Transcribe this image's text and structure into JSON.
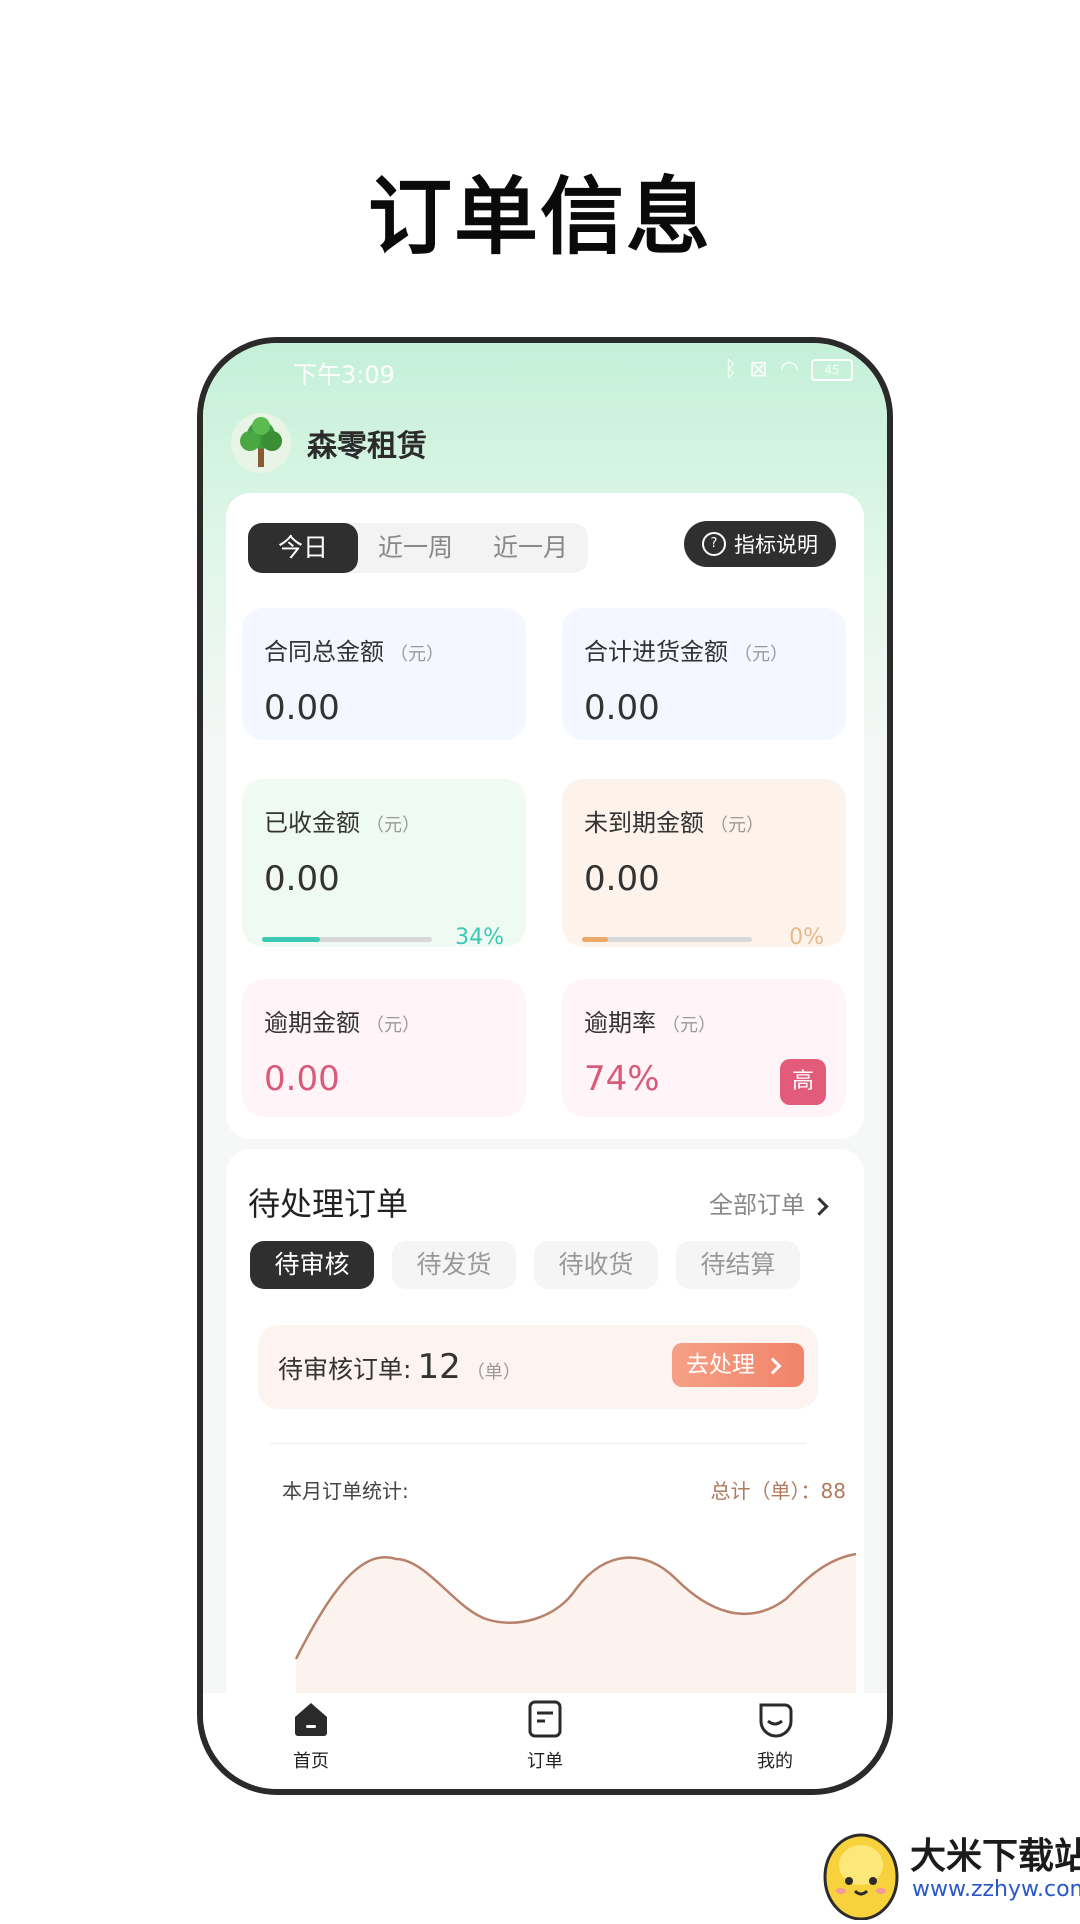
{
  "hero": {
    "title": "订单信息"
  },
  "status_bar": {
    "time": "下午3:09",
    "battery": "45"
  },
  "app": {
    "name": "森零租赁"
  },
  "overview": {
    "periods": [
      "今日",
      "近一周",
      "近一月"
    ],
    "selected_period": "今日",
    "explain_label": "指标说明",
    "metrics": [
      {
        "title": "合同总金额",
        "unit": "（元）",
        "value": "0.00"
      },
      {
        "title": "合计进货金额",
        "unit": "（元）",
        "value": "0.00"
      },
      {
        "title": "已收金额",
        "unit": "（元）",
        "value": "0.00",
        "progress": 34,
        "progress_label": "34%"
      },
      {
        "title": "未到期金额",
        "unit": "（元）",
        "value": "0.00",
        "progress": 0,
        "progress_label": "0%"
      },
      {
        "title": "逾期金额",
        "unit": "（元）",
        "value": "0.00"
      },
      {
        "title": "逾期率",
        "unit": "（元）",
        "value": "74%",
        "badge": "高"
      }
    ]
  },
  "orders": {
    "title": "待处理订单",
    "all_label": "全部订单",
    "tabs": [
      "待审核",
      "待发货",
      "待收货",
      "待结算"
    ],
    "selected_tab": "待审核",
    "pending": {
      "label": "待审核订单:",
      "count": "12",
      "unit": "（单）",
      "action": "去处理"
    },
    "stats_label": "本月订单统计:",
    "total_label": "总计（单）：88"
  },
  "colors": {
    "accent_dark": "#2f2f2f",
    "teal": "#3cc9b4",
    "orange": "#f0a868",
    "danger": "#e35b7a",
    "chart_line": "#b8826a"
  },
  "tabbar": {
    "items": [
      "首页",
      "订单",
      "我的"
    ],
    "selected": "首页"
  },
  "watermark": {
    "text": "大米下载站",
    "url": "www.zzhyw.com"
  }
}
